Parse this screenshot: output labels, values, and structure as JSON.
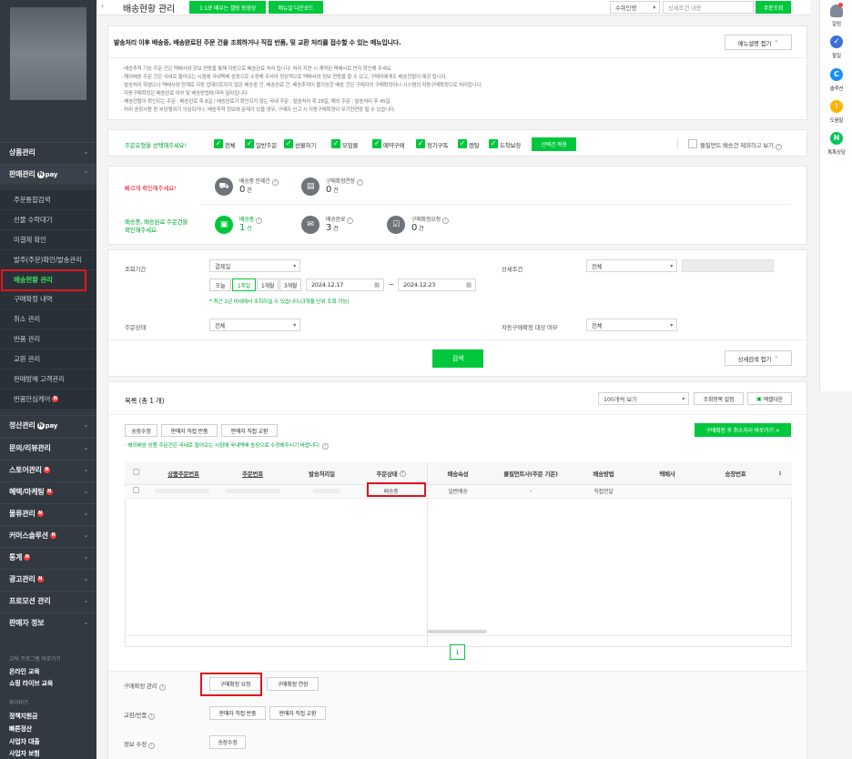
{
  "sidebar": {
    "groups": [
      {
        "label": "상품관리"
      },
      {
        "label": "판매관리",
        "pay": "pay"
      },
      {
        "label": "정산관리",
        "pay": "pay"
      },
      {
        "label": "문의/리뷰관리"
      },
      {
        "label": "스토어관리",
        "badge": "N"
      },
      {
        "label": "혜택/마케팅",
        "badge": "N"
      },
      {
        "label": "물류관리",
        "badge": "N"
      },
      {
        "label": "커머스솔루션",
        "badge": "N"
      },
      {
        "label": "통계",
        "badge": "N"
      },
      {
        "label": "광고관리",
        "badge": "N"
      },
      {
        "label": "프로모션 관리"
      },
      {
        "label": "판매자 정보"
      }
    ],
    "sub": [
      {
        "label": "주문통합검색"
      },
      {
        "label": "선물 수락대기"
      },
      {
        "label": "미결제 확인"
      },
      {
        "label": "발주(주문)확인/발송관리"
      },
      {
        "label": "배송현황 관리"
      },
      {
        "label": "구매확정 내역"
      },
      {
        "label": "취소 관리"
      },
      {
        "label": "반품 관리"
      },
      {
        "label": "교환 관리"
      },
      {
        "label": "판매방해 고객관리"
      },
      {
        "label": "반품안심케어",
        "badge": "N"
      }
    ],
    "footer": {
      "edu_title": "교육 프로그램 바로가기",
      "edu1": "온라인 교육",
      "edu2": "쇼핑 라이브 교육",
      "biz_title": "파이비즈",
      "biz1": "정책지원금",
      "biz2": "빠른정산",
      "biz3": "사업자 대출",
      "biz4": "사업자 보험"
    }
  },
  "topbar": {
    "title": "배송현황 관리",
    "btn1": "1:1로 배우는 셀링 동영상",
    "btn2": "매뉴얼 다운로드",
    "select": "수취인명",
    "search_placeholder": "상세조건 내용",
    "search_btn": "주문조회"
  },
  "notice": {
    "title": "발송처리 이후 배송중, 배송완료된 주문 건을 조회하거나 직접 반품, 및 교환 처리를 접수할 수 있는 메뉴입니다.",
    "collapse": "메뉴설명 접기",
    "lines": [
      "· 배송추적 기능 주문 건은 택배사와 정보 연동을 통해 자동으로 배송완료 처리 됩니다. 처리 지연 시 계약된 택배사로 먼저 확인해 주세요.",
      "· 해외배송 주문 건은 국내로 들어오는 시점에 국내택배 송장으로 수정해 주셔야 정상적으로 택배사와 정보 연동을 할 수 있고, 구매자에게도 배송현황이 제공 됩니다.",
      "· 발송처리 하였으나 택배사와 연계로 자동 업데이트되지 않은 배송중 건, 배송완료 건, 배송추적이 불가능한 배송 건은 구매자의 구매확정이나 시스템의 자동구매확정으로 처리됩니다.",
      "· 자동구매확정은 배송완료 여부 및 배송방법에 따라 달라집니다.",
      "   - 배송현황이 확인되는 주문 : 배송완료 후 8일 / 배송완료가 확인되지 않는 국내 주문 : 발송처리 후 28일, 해외 주문 : 발송처리 후 45일",
      "· 허위 송장사용 등 부당행위가 의심되거나, 배송추적 정보에 문제가 있을 경우, 구매자 신고 시 자동구매확정이 무기한연장 될 수 있습니다."
    ]
  },
  "filter": {
    "label": "주문유형을 선택해주세요!",
    "options": [
      "전체",
      "일반주문",
      "선물하기",
      "모임물",
      "예약구매",
      "정기구독",
      "렌탈",
      "도착보장"
    ],
    "apply": "선택건 적용",
    "exclude": "풀필먼트 배송건 제외하고 보기"
  },
  "stats": {
    "row1_label": "빠르게 확인해주세요!",
    "row2_label_1": "배송중, 배송완료 주문건을",
    "row2_label_2": "확인해주세요.",
    "cards": [
      {
        "label": "배송중 문제건",
        "value": "0",
        "unit": "건"
      },
      {
        "label": "구매확정연장",
        "value": "0",
        "unit": "건"
      },
      {
        "label": "배송중",
        "value": "1",
        "unit": "건"
      },
      {
        "label": "배송완료",
        "value": "3",
        "unit": "건"
      },
      {
        "label": "구매확정요청",
        "value": "0",
        "unit": "건"
      }
    ]
  },
  "search": {
    "period_label": "조회기간",
    "period_select": "결제일",
    "ranges": [
      "오늘",
      "1주일",
      "1개월",
      "3개월"
    ],
    "date_from": "2024.12.17",
    "date_sep": "~",
    "date_to": "2024.12.23",
    "hint": "* 최근 1년 이내에서 조회하실 수 있습니다.(3개월 단위 조회 가능)",
    "detail_label": "상세조건",
    "detail_select": "전체",
    "status_label": "주문상태",
    "status_select": "전체",
    "auto_label": "자동구매확정 대상 여부",
    "auto_select": "전체",
    "search_btn": "검색",
    "collapse": "상세검색 접기"
  },
  "list": {
    "title": "목록 (총 1 개)",
    "view_select": "100개씩 보기",
    "settings_btn": "조회항목 설정",
    "excel_btn": "엑셀다운",
    "actions": [
      "송장수정",
      "판매자 직접 반품",
      "판매자 직접 교환"
    ],
    "right_btn": "구매확정 후 취소처리 바로가기 >",
    "note": "· 해외배송 상품 주문건은 국내로 들어오는 시점에 국내택배 송장으로 수정해주시기 바랍니다.",
    "columns": [
      "상품주문번호",
      "주문번호",
      "발송처리일",
      "주문상태",
      "배송속성",
      "풀필먼트사(주문 기준)",
      "배송방법",
      "택배사",
      "송장번호"
    ],
    "rows": [
      {
        "status": "배송중",
        "attr": "일반배송",
        "fulfill": "-",
        "method": "직접전달"
      }
    ],
    "page": "1"
  },
  "bottom": {
    "confirm_label": "구매확정 관리",
    "confirm_btn1": "구매확정 요청",
    "confirm_btn2": "구매확정 연장",
    "return_label": "교환/반품",
    "return_btn1": "판매자 직접 반품",
    "return_btn2": "판매자 직접 교환",
    "info_label": "정보 수정",
    "info_btn": "송장수정"
  },
  "rail": {
    "items": [
      {
        "label": "알림",
        "icon": "bell-icon"
      },
      {
        "label": "할일",
        "icon": "check-icon"
      },
      {
        "label": "솔루션",
        "icon": "solution-icon"
      },
      {
        "label": "도움말",
        "icon": "help-icon"
      },
      {
        "label": "톡톡상담",
        "icon": "talk-icon"
      }
    ]
  },
  "colors": {
    "accent": "#00c73c",
    "sidebar": "#323941",
    "highlight": "#e2141c"
  }
}
